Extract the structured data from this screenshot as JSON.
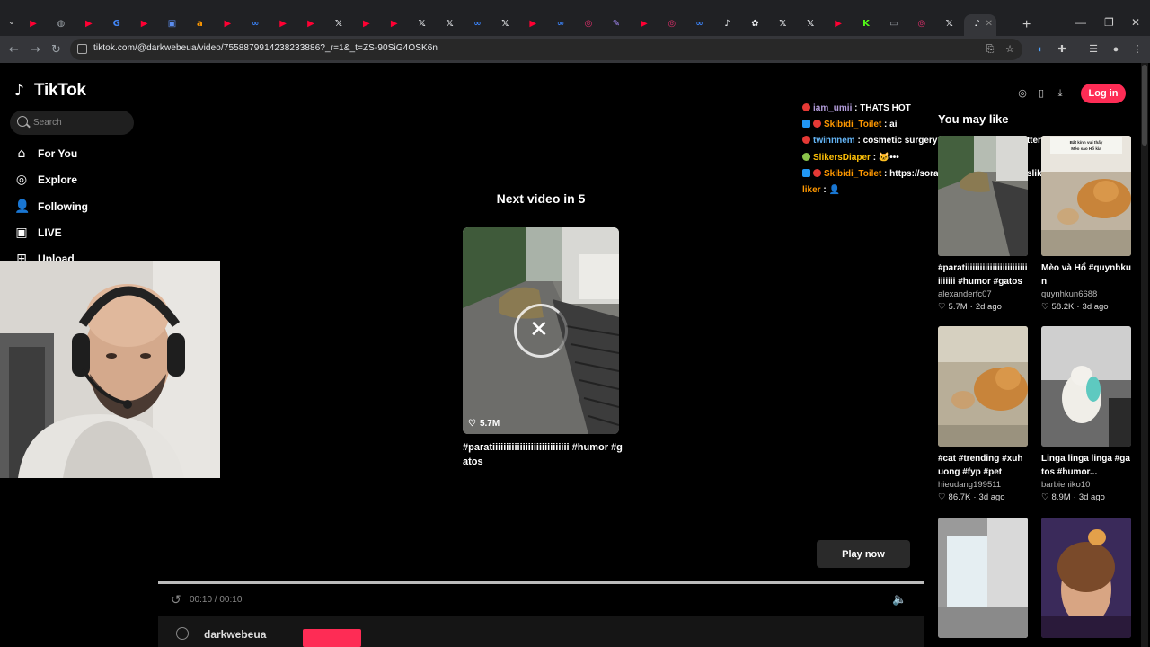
{
  "browser": {
    "url": "tiktok.com/@darkwebeua/video/7558879914238233886?_r=1&_t=ZS-90SiG4OSK6n",
    "tabs": [
      {
        "icon": "youtube-icon",
        "color": "#ff0033",
        "glyph": "▶"
      },
      {
        "icon": "globe-icon",
        "color": "#9aa0a6",
        "glyph": "◍"
      },
      {
        "icon": "youtube-icon",
        "color": "#ff0033",
        "glyph": "▶"
      },
      {
        "icon": "google-icon",
        "color": "#4285f4",
        "glyph": "G"
      },
      {
        "icon": "youtube-icon",
        "color": "#ff0033",
        "glyph": "▶"
      },
      {
        "icon": "app-icon",
        "color": "#5b8def",
        "glyph": "▣"
      },
      {
        "icon": "amazon-icon",
        "color": "#ff9900",
        "glyph": "a"
      },
      {
        "icon": "youtube-icon",
        "color": "#ff0033",
        "glyph": "▶"
      },
      {
        "icon": "chatgpt-icon",
        "color": "#3b82f6",
        "glyph": "∞"
      },
      {
        "icon": "youtube-icon",
        "color": "#ff0033",
        "glyph": "▶"
      },
      {
        "icon": "youtube-icon",
        "color": "#ff0033",
        "glyph": "▶"
      },
      {
        "icon": "x-icon",
        "color": "#e8eaed",
        "glyph": "𝕏"
      },
      {
        "icon": "youtube-icon",
        "color": "#ff0033",
        "glyph": "▶"
      },
      {
        "icon": "youtube-icon",
        "color": "#ff0033",
        "glyph": "▶"
      },
      {
        "icon": "x-icon",
        "color": "#e8eaed",
        "glyph": "𝕏"
      },
      {
        "icon": "x-icon",
        "color": "#e8eaed",
        "glyph": "𝕏"
      },
      {
        "icon": "meta-icon",
        "color": "#3b82f6",
        "glyph": "∞"
      },
      {
        "icon": "x-icon",
        "color": "#e8eaed",
        "glyph": "𝕏"
      },
      {
        "icon": "youtube-icon",
        "color": "#ff0033",
        "glyph": "▶"
      },
      {
        "icon": "meta-icon",
        "color": "#3b82f6",
        "glyph": "∞"
      },
      {
        "icon": "instagram-icon",
        "color": "#e1306c",
        "glyph": "◎"
      },
      {
        "icon": "feather-icon",
        "color": "#a78bfa",
        "glyph": "✎"
      },
      {
        "icon": "youtube-icon",
        "color": "#ff0033",
        "glyph": "▶"
      },
      {
        "icon": "instagram-icon",
        "color": "#e1306c",
        "glyph": "◎"
      },
      {
        "icon": "meta-icon",
        "color": "#3b82f6",
        "glyph": "∞"
      },
      {
        "icon": "tiktok-icon",
        "color": "#e8eaed",
        "glyph": "♪"
      },
      {
        "icon": "openai-icon",
        "color": "#e8eaed",
        "glyph": "✿"
      },
      {
        "icon": "x-icon",
        "color": "#e8eaed",
        "glyph": "𝕏"
      },
      {
        "icon": "x-icon",
        "color": "#e8eaed",
        "glyph": "𝕏"
      },
      {
        "icon": "youtube-icon",
        "color": "#ff0033",
        "glyph": "▶"
      },
      {
        "icon": "kick-icon",
        "color": "#53fc18",
        "glyph": "K"
      },
      {
        "icon": "window-icon",
        "color": "#9aa0a6",
        "glyph": "▭"
      },
      {
        "icon": "instagram-icon",
        "color": "#e1306c",
        "glyph": "◎"
      },
      {
        "icon": "x-icon",
        "color": "#e8eaed",
        "glyph": "𝕏"
      },
      {
        "icon": "tiktok-icon",
        "color": "#e8eaed",
        "glyph": "♪"
      }
    ]
  },
  "sidebar": {
    "logo": "TikTok",
    "search_placeholder": "Search",
    "nav": [
      {
        "label": "For You",
        "icon": "home-icon",
        "glyph": "⌂"
      },
      {
        "label": "Explore",
        "icon": "compass-icon",
        "glyph": "◎"
      },
      {
        "label": "Following",
        "icon": "person-icon",
        "glyph": "👤"
      },
      {
        "label": "LIVE",
        "icon": "live-icon",
        "glyph": "▣"
      },
      {
        "label": "Upload",
        "icon": "plus-icon",
        "glyph": "⊞"
      }
    ]
  },
  "player": {
    "next_title": "Next video in 5",
    "likes": "5.7M",
    "caption": "#paratiiiiiiiiiiiiiiiiiiiiiiiiiiii #humor #gatos",
    "play_now": "Play now",
    "timecode": "00:10 / 00:10",
    "progress": 1.0,
    "author": "darkwebeua"
  },
  "header": {
    "login": "Log in"
  },
  "chat": [
    {
      "user": "iam_umii",
      "msg": "THATS HOT",
      "color": "#b39ddb",
      "badge": "#e53935",
      "badge2": ""
    },
    {
      "user": "Skibidi_Toilet",
      "msg": "ai",
      "color": "#ff9800",
      "badge": "#e53935",
      "badge2": "#2196f3"
    },
    {
      "user": "twinnnem",
      "msg": "cosmetic surgery and aint shit look better",
      "color": "#64b5f6",
      "badge": "#e53935",
      "badge2": ""
    },
    {
      "user": "SlikersDiaper",
      "msg": "🐱•••",
      "color": "#ffc107",
      "badge": "#8bc34a",
      "badge2": ""
    },
    {
      "user": "Skibidi_Toilet",
      "msg": "https://sora.chatgpt.com/profile/sliker0161",
      "color": "#ff9800",
      "badge": "#e53935",
      "badge2": "#2196f3"
    },
    {
      "user": "liker",
      "msg": "👤",
      "color": "#ff9800",
      "badge": "",
      "badge2": ""
    }
  ],
  "recommendations": {
    "title": "You may like",
    "items": [
      {
        "caption": "#paratiiiiiiiiiiiiiiiiiiiiiiiiiiiiiiii #humor #gatos",
        "author": "alexanderfc07",
        "likes": "5.7M",
        "age": "2d ago"
      },
      {
        "caption": "Mèo và Hổ #quynhkun",
        "author": "quynhkun6688",
        "likes": "58.2K",
        "age": "3d ago"
      },
      {
        "caption": "#cat #trending #xuhuong #fyp #pet",
        "author": "hieudang199511",
        "likes": "86.7K",
        "age": "3d ago"
      },
      {
        "caption": "Linga linga linga #gatos #humor...",
        "author": "barbieniko10",
        "likes": "8.9M",
        "age": "3d ago"
      },
      {
        "caption": "",
        "author": "",
        "likes": "",
        "age": ""
      },
      {
        "caption": "",
        "author": "",
        "likes": "",
        "age": ""
      }
    ],
    "thumb_text": "Bất kính vui thấy Mèo sao Hổ kìa"
  }
}
